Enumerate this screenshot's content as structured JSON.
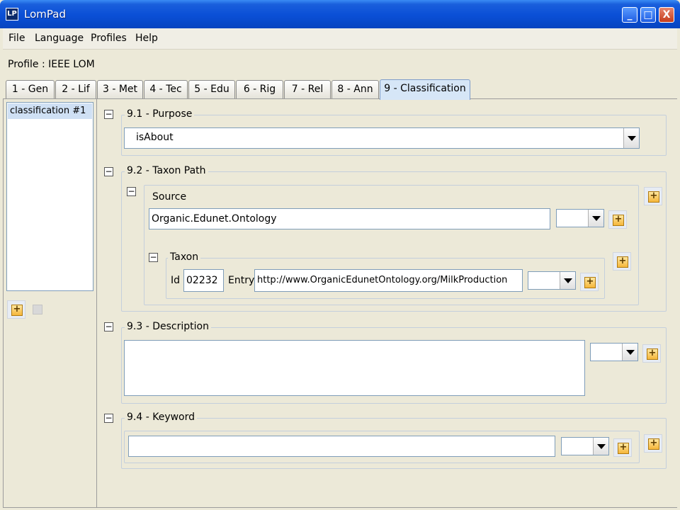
{
  "window": {
    "title": "LomPad",
    "controls": [
      "_",
      "□",
      "X"
    ]
  },
  "menu": [
    "File",
    "Language",
    "Profiles",
    "Help"
  ],
  "profile_label": "Profile : IEEE LOM",
  "tabs": [
    "1 - Gen",
    "2 - Lif",
    "3 - Met",
    "4 - Tec",
    "5 - Edu",
    "6 - Rig",
    "7 - Rel",
    "8 - Ann",
    "9 - Classification"
  ],
  "active_tab": "9 - Classification",
  "left_list": {
    "items": [
      "classification #1"
    ]
  },
  "sections": {
    "purpose": {
      "title": "9.1 - Purpose",
      "value": "isAbout"
    },
    "taxon_path": {
      "title": "9.2 - Taxon Path",
      "source": {
        "title": "Source",
        "value": "Organic.Edunet.Ontology",
        "language": ""
      },
      "taxon": {
        "title": "Taxon",
        "id_label": "Id",
        "id_value": "02232",
        "entry_label": "Entry",
        "entry_value": "http://www.OrganicEdunetOntology.org/MilkProduction",
        "language": ""
      }
    },
    "description": {
      "title": "9.3 - Description",
      "value": "",
      "language": ""
    },
    "keyword": {
      "title": "9.4 - Keyword",
      "value": "",
      "language": ""
    }
  },
  "icons": {
    "collapse": "minus-box-icon",
    "add": "plus-icon",
    "dropdown": "chevron-down-icon"
  },
  "colors": {
    "titlebar": "#0a4fd6",
    "active_tab": "#d6e6f7",
    "selection": "#cfe0f4"
  }
}
